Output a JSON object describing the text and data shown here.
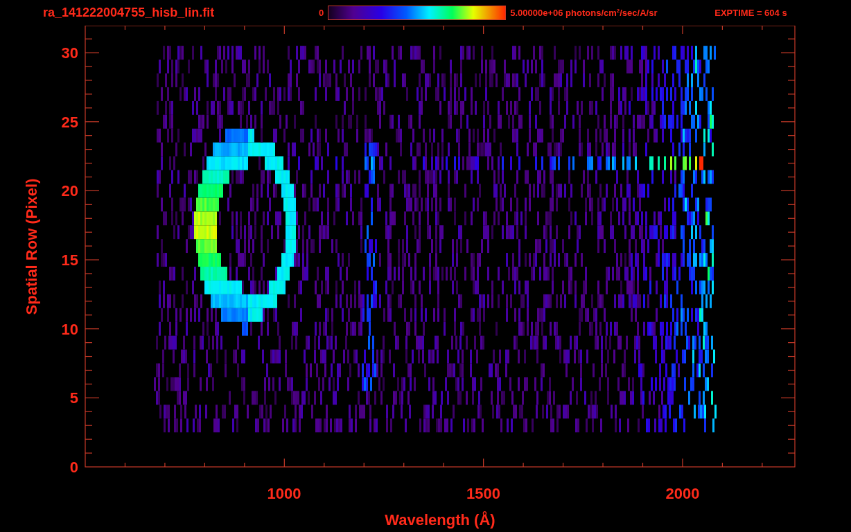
{
  "title": "ra_141222004755_hisb_lin.fit",
  "colorbar": {
    "min_label": "0",
    "max_label": "5.00000e+06 photons/cm$^{2}$/sec/A/sr"
  },
  "exposure": "EXPTIME = 604 s",
  "plot": {
    "xlabel": "Wavelength (Å)",
    "ylabel": "Spatial Row (Pixel)",
    "xtick_labels": [
      "1000",
      "1500",
      "2000"
    ],
    "ytick_labels": [
      "30",
      "25",
      "20",
      "15",
      "10",
      "5",
      "0"
    ]
  }
}
